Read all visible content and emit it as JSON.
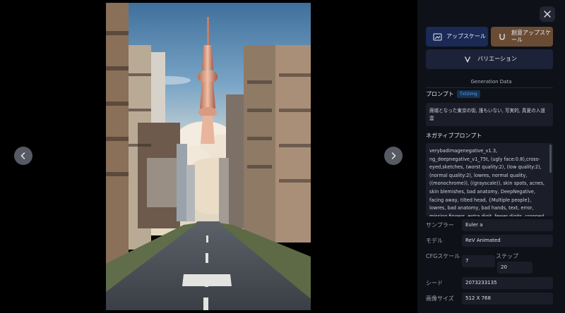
{
  "viewer": {
    "prev_icon": "chevron-left-icon",
    "next_icon": "chevron-right-icon",
    "image_icon": "generated-image"
  },
  "panel": {
    "close_icon": "close-icon",
    "buttons": {
      "upscale": {
        "label": "アップスケール",
        "icon": "image-upscale-icon"
      },
      "creative_upscale": {
        "label": "創意アップスケール",
        "icon": "magnet-icon"
      },
      "variation": {
        "label": "バリエーション",
        "icon": "v-icon"
      }
    },
    "generation_title": "Generation Data",
    "prompt": {
      "label": "プロンプト",
      "tag": "Txt2img",
      "text": "廃墟となった東京の街, 誰もいない, 写実的, 真夏の入道雲"
    },
    "negative_prompt": {
      "label": "ネガティブプロンプト",
      "text": "verybadimagenegative_v1.3, ng_deepnegative_v1_75t, (ugly face:0.8),cross-eyed,sketches, (worst quality:2), (low quality:2), (normal quality:2), lowres, normal quality, ((monochrome)), ((grayscale)), skin spots, acnes, skin blemishes, bad anatomy, DeepNegative, facing away, tilted head, {Multiple people}, lowres, bad anatomy, bad hands, text, error, missing fingers, extra digit, fewer digits, cropped, worstquality, low"
    },
    "fields": {
      "sampler": {
        "label": "サンプラー",
        "value": "Euler a"
      },
      "model": {
        "label": "モデル",
        "value": "ReV Animated"
      },
      "cfg": {
        "label": "CFGスケール",
        "value": "7"
      },
      "steps": {
        "label": "ステップ",
        "value": "20"
      },
      "seed": {
        "label": "シード",
        "value": "2073233135"
      },
      "size": {
        "label": "画像サイズ",
        "value": "512 X 768"
      }
    }
  }
}
